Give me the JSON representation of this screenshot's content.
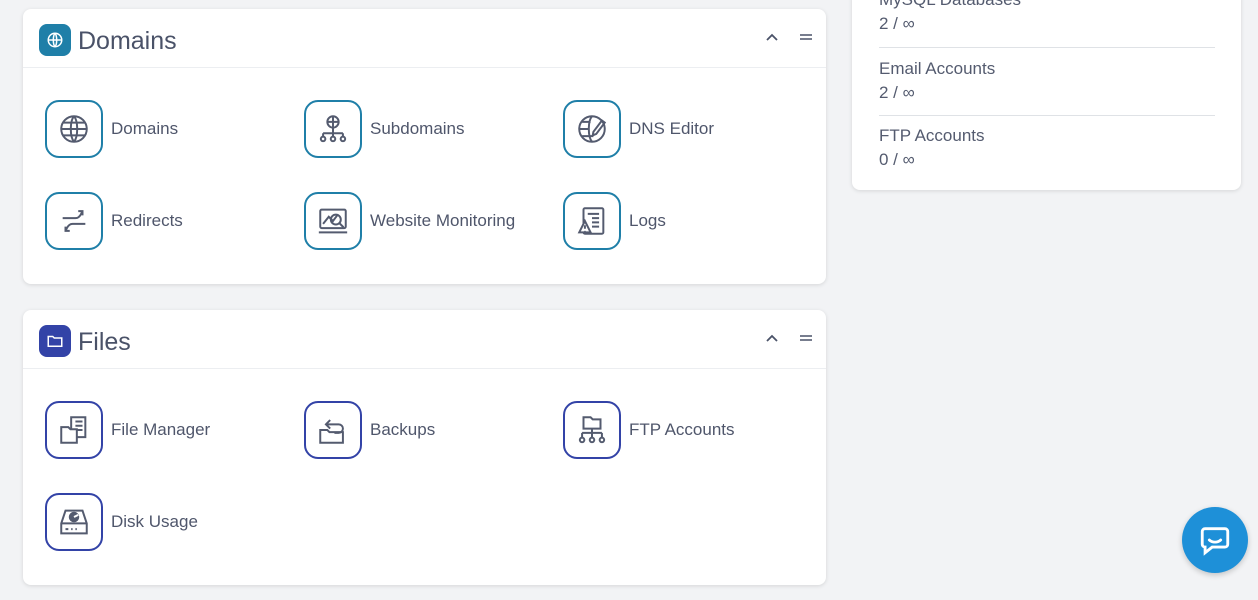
{
  "stats": [
    {
      "label": "MySQL Databases",
      "value": "2 / ∞"
    },
    {
      "label": "Email Accounts",
      "value": "2 / ∞"
    },
    {
      "label": "FTP Accounts",
      "value": "0 / ∞"
    }
  ],
  "domains_panel": {
    "title": "Domains",
    "badge_color": "#1f7fa8",
    "icon": "globe-icon",
    "items": [
      {
        "label": "Domains",
        "icon": "globe-icon"
      },
      {
        "label": "Subdomains",
        "icon": "network-node-icon"
      },
      {
        "label": "DNS Editor",
        "icon": "dns-globe-pen-icon"
      },
      {
        "label": "Redirects",
        "icon": "redirect-arrows-icon"
      },
      {
        "label": "Website Monitoring",
        "icon": "monitor-chart-icon"
      },
      {
        "label": "Logs",
        "icon": "log-document-warning-icon"
      }
    ]
  },
  "files_panel": {
    "title": "Files",
    "badge_color": "#3343a7",
    "icon": "folder-icon",
    "items": [
      {
        "label": "File Manager",
        "icon": "file-manager-icon"
      },
      {
        "label": "Backups",
        "icon": "backup-folder-icon"
      },
      {
        "label": "FTP Accounts",
        "icon": "ftp-network-folder-icon"
      },
      {
        "label": "Disk Usage",
        "icon": "disk-drive-icon"
      }
    ]
  },
  "colors": {
    "domains_accent": "#1f7fa8",
    "files_accent": "#3343a7",
    "chat_button": "#1e90d8",
    "background": "#f2f3f5"
  },
  "chat": {
    "icon": "chat-bubble-icon"
  }
}
